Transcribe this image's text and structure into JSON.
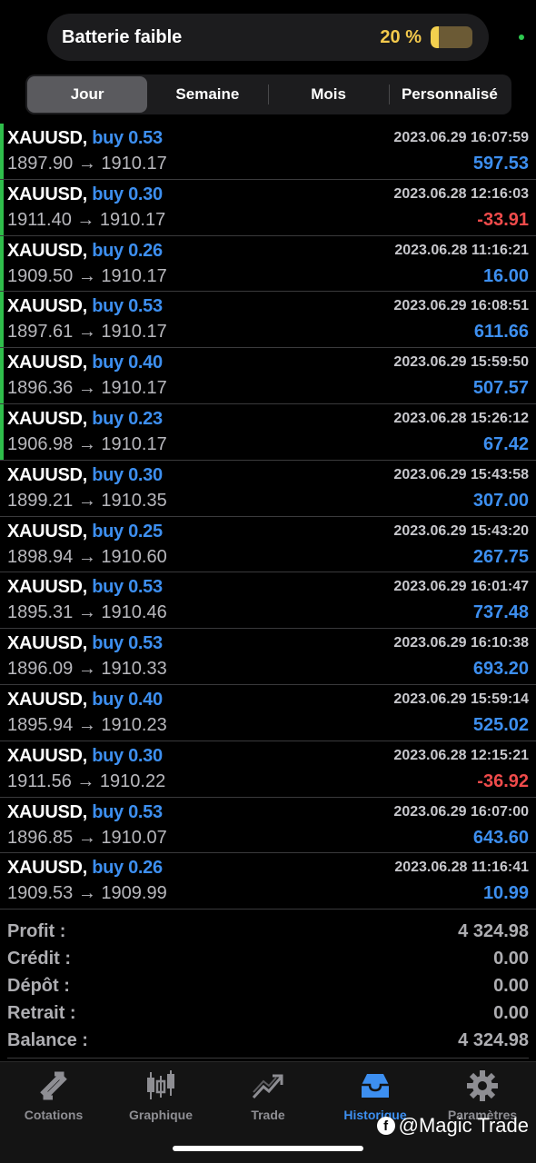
{
  "battery": {
    "title": "Batterie faible",
    "percent_text": "20 %",
    "level": 0.2
  },
  "tabs_period": [
    "Jour",
    "Semaine",
    "Mois",
    "Personnalisé"
  ],
  "trades": [
    {
      "symbol": "XAUUSD,",
      "side": "buy 0.53",
      "time": "2023.06.29 16:07:59",
      "prices": "1897.90 → 1910.17",
      "profit": "597.53",
      "neg": false,
      "open": true
    },
    {
      "symbol": "XAUUSD,",
      "side": "buy 0.30",
      "time": "2023.06.28 12:16:03",
      "prices": "1911.40 → 1910.17",
      "profit": "-33.91",
      "neg": true,
      "open": true
    },
    {
      "symbol": "XAUUSD,",
      "side": "buy 0.26",
      "time": "2023.06.28 11:16:21",
      "prices": "1909.50 → 1910.17",
      "profit": "16.00",
      "neg": false,
      "open": true
    },
    {
      "symbol": "XAUUSD,",
      "side": "buy 0.53",
      "time": "2023.06.29 16:08:51",
      "prices": "1897.61 → 1910.17",
      "profit": "611.66",
      "neg": false,
      "open": true
    },
    {
      "symbol": "XAUUSD,",
      "side": "buy 0.40",
      "time": "2023.06.29 15:59:50",
      "prices": "1896.36 → 1910.17",
      "profit": "507.57",
      "neg": false,
      "open": true
    },
    {
      "symbol": "XAUUSD,",
      "side": "buy 0.23",
      "time": "2023.06.28 15:26:12",
      "prices": "1906.98 → 1910.17",
      "profit": "67.42",
      "neg": false,
      "open": true
    },
    {
      "symbol": "XAUUSD,",
      "side": "buy 0.30",
      "time": "2023.06.29 15:43:58",
      "prices": "1899.21 → 1910.35",
      "profit": "307.00",
      "neg": false,
      "open": false
    },
    {
      "symbol": "XAUUSD,",
      "side": "buy 0.25",
      "time": "2023.06.29 15:43:20",
      "prices": "1898.94 → 1910.60",
      "profit": "267.75",
      "neg": false,
      "open": false
    },
    {
      "symbol": "XAUUSD,",
      "side": "buy 0.53",
      "time": "2023.06.29 16:01:47",
      "prices": "1895.31 → 1910.46",
      "profit": "737.48",
      "neg": false,
      "open": false
    },
    {
      "symbol": "XAUUSD,",
      "side": "buy 0.53",
      "time": "2023.06.29 16:10:38",
      "prices": "1896.09 → 1910.33",
      "profit": "693.20",
      "neg": false,
      "open": false
    },
    {
      "symbol": "XAUUSD,",
      "side": "buy 0.40",
      "time": "2023.06.29 15:59:14",
      "prices": "1895.94 → 1910.23",
      "profit": "525.02",
      "neg": false,
      "open": false
    },
    {
      "symbol": "XAUUSD,",
      "side": "buy 0.30",
      "time": "2023.06.28 12:15:21",
      "prices": "1911.56 → 1910.22",
      "profit": "-36.92",
      "neg": true,
      "open": false
    },
    {
      "symbol": "XAUUSD,",
      "side": "buy 0.53",
      "time": "2023.06.29 16:07:00",
      "prices": "1896.85 → 1910.07",
      "profit": "643.60",
      "neg": false,
      "open": false
    },
    {
      "symbol": "XAUUSD,",
      "side": "buy 0.26",
      "time": "2023.06.28 11:16:41",
      "prices": "1909.53 → 1909.99",
      "profit": "10.99",
      "neg": false,
      "open": false
    }
  ],
  "summary": [
    {
      "label": "Profit :",
      "value": "4 324.98"
    },
    {
      "label": "Crédit :",
      "value": "0.00"
    },
    {
      "label": "Dépôt :",
      "value": "0.00"
    },
    {
      "label": "Retrait :",
      "value": "0.00"
    },
    {
      "label": "Balance :",
      "value": "4 324.98"
    }
  ],
  "tabbar": [
    {
      "label": "Cotations",
      "icon": "quotes-arrows-icon"
    },
    {
      "label": "Graphique",
      "icon": "candlestick-chart-icon"
    },
    {
      "label": "Trade",
      "icon": "trade-trend-icon"
    },
    {
      "label": "Historique",
      "icon": "history-inbox-icon"
    },
    {
      "label": "Paramètres",
      "icon": "gear-icon"
    }
  ],
  "watermark": "@Magic Trade",
  "colors": {
    "accent": "#3d8ff0",
    "negative": "#f04b4b",
    "open_marker": "#2fbe4b",
    "battery": "#f3c94c"
  }
}
